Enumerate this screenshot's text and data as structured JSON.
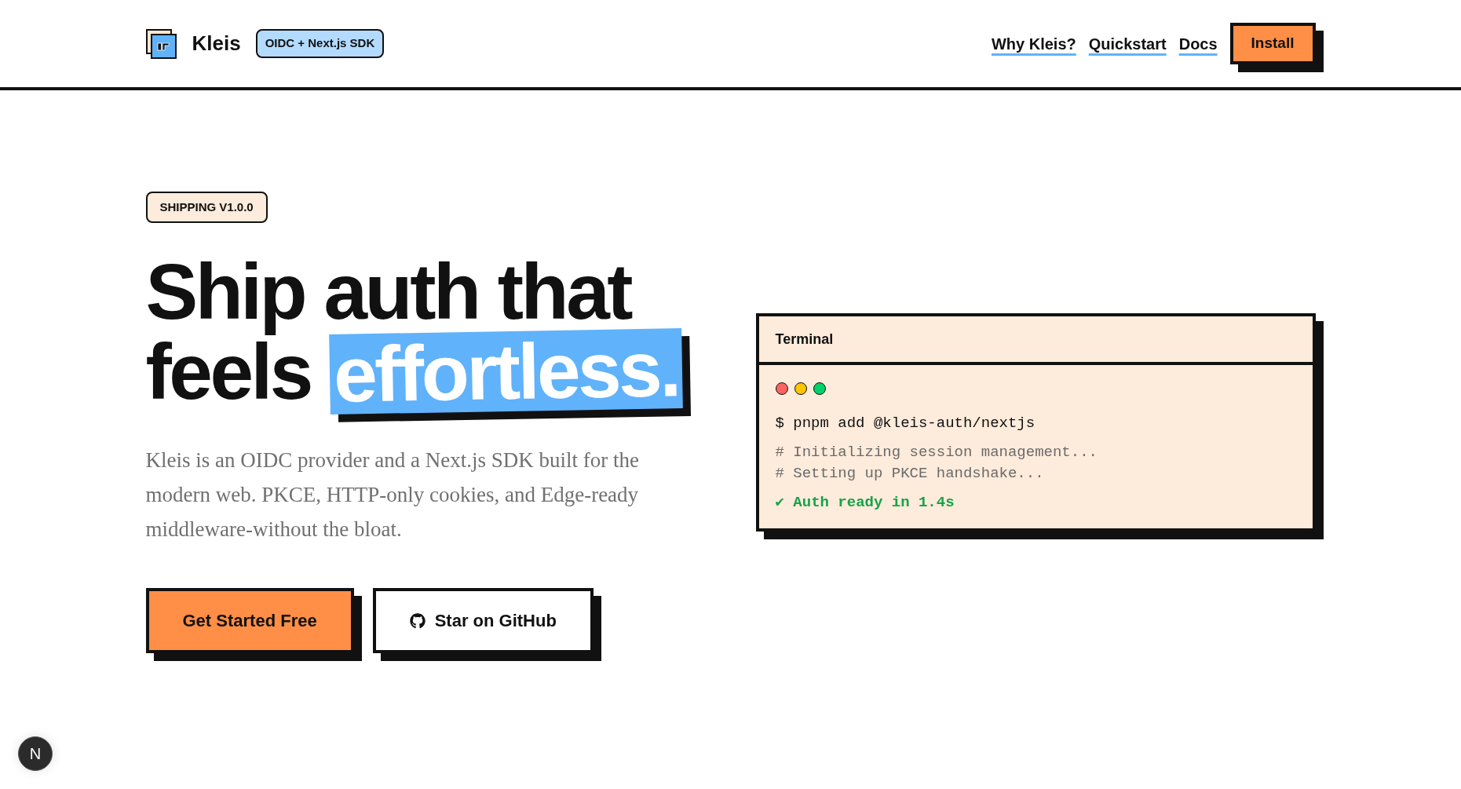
{
  "header": {
    "brand": "Kleis",
    "badge": "OIDC + Next.js SDK",
    "nav_links": [
      "Why Kleis?",
      "Quickstart",
      "Docs"
    ],
    "install_button": "Install"
  },
  "hero": {
    "badge": "SHIPPING V1.0.0",
    "heading_line_1": "Ship auth that",
    "heading_line_2": "feels",
    "heading_highlight": "effortless.",
    "description": "Kleis is an OIDC provider and a Next.js SDK built for the modern web. PKCE, HTTP-only cookies, and Edge-ready middleware-without the bloat.",
    "buttons": [
      {
        "label": "Get Started Free",
        "kind": "primary"
      },
      {
        "label": "Star on GitHub",
        "kind": "github"
      }
    ]
  },
  "terminal": {
    "title": "Terminal",
    "window_dots": [
      {
        "color": "#ff6363"
      },
      {
        "color": "#ffc400"
      },
      {
        "color": "#00d26a"
      }
    ],
    "lines": [
      {
        "kind": "command",
        "text": "$ pnpm add @kleis-auth/nextjs"
      },
      {
        "kind": "comment",
        "text": "# Initializing session management..."
      },
      {
        "kind": "comment",
        "text": "# Setting up PKCE handshake..."
      },
      {
        "kind": "success",
        "text": "✔ Auth ready in 1.4s"
      }
    ]
  },
  "dev_indicator": {
    "label": "N"
  }
}
